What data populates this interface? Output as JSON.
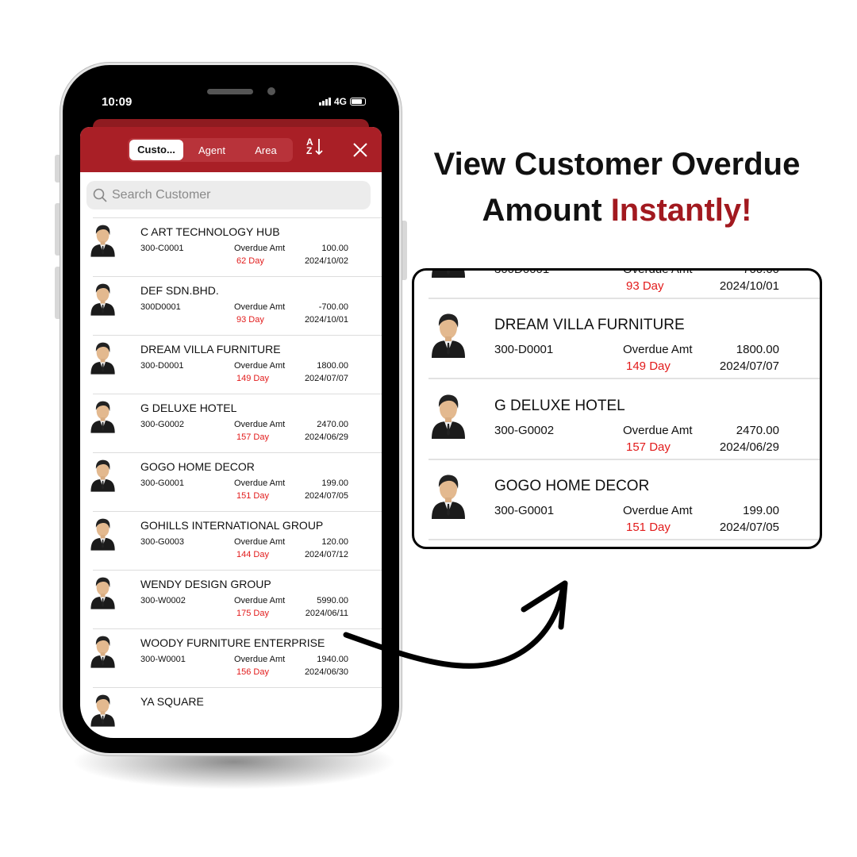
{
  "status_bar": {
    "time": "10:09",
    "network": "4G"
  },
  "header": {
    "tabs": [
      {
        "label": "Custo...",
        "active": true
      },
      {
        "label": "Agent",
        "active": false
      },
      {
        "label": "Area",
        "active": false
      }
    ],
    "sort_icon": "sort-az-icon",
    "close_icon": "close-icon",
    "sort_label_a": "A",
    "sort_label_z": "Z"
  },
  "search": {
    "placeholder": "Search Customer"
  },
  "customers": [
    {
      "name": "C ART TECHNOLOGY HUB",
      "code": "300-C0001",
      "label": "Overdue Amt",
      "amount": "100.00",
      "days": "62 Day",
      "date": "2024/10/02"
    },
    {
      "name": "DEF SDN.BHD.",
      "code": "300D0001",
      "label": "Overdue Amt",
      "amount": "-700.00",
      "days": "93 Day",
      "date": "2024/10/01"
    },
    {
      "name": "DREAM VILLA FURNITURE",
      "code": "300-D0001",
      "label": "Overdue Amt",
      "amount": "1800.00",
      "days": "149 Day",
      "date": "2024/07/07"
    },
    {
      "name": "G DELUXE HOTEL",
      "code": "300-G0002",
      "label": "Overdue Amt",
      "amount": "2470.00",
      "days": "157 Day",
      "date": "2024/06/29"
    },
    {
      "name": "GOGO HOME DECOR",
      "code": "300-G0001",
      "label": "Overdue Amt",
      "amount": "199.00",
      "days": "151 Day",
      "date": "2024/07/05"
    },
    {
      "name": "GOHILLS INTERNATIONAL GROUP",
      "code": "300-G0003",
      "label": "Overdue Amt",
      "amount": "120.00",
      "days": "144 Day",
      "date": "2024/07/12"
    },
    {
      "name": "WENDY DESIGN GROUP",
      "code": "300-W0002",
      "label": "Overdue Amt",
      "amount": "5990.00",
      "days": "175 Day",
      "date": "2024/06/11"
    },
    {
      "name": "WOODY FURNITURE ENTERPRISE",
      "code": "300-W0001",
      "label": "Overdue Amt",
      "amount": "1940.00",
      "days": "156 Day",
      "date": "2024/06/30"
    },
    {
      "name": "YA SQUARE"
    }
  ],
  "headline": {
    "line1": "View Customer Overdue",
    "line2_plain": "Amount ",
    "line2_highlight": "Instantly!",
    "highlight_color": "#a2191f"
  },
  "colors": {
    "brand_red": "#a91f26",
    "overdue_days": "#e21b1b"
  }
}
